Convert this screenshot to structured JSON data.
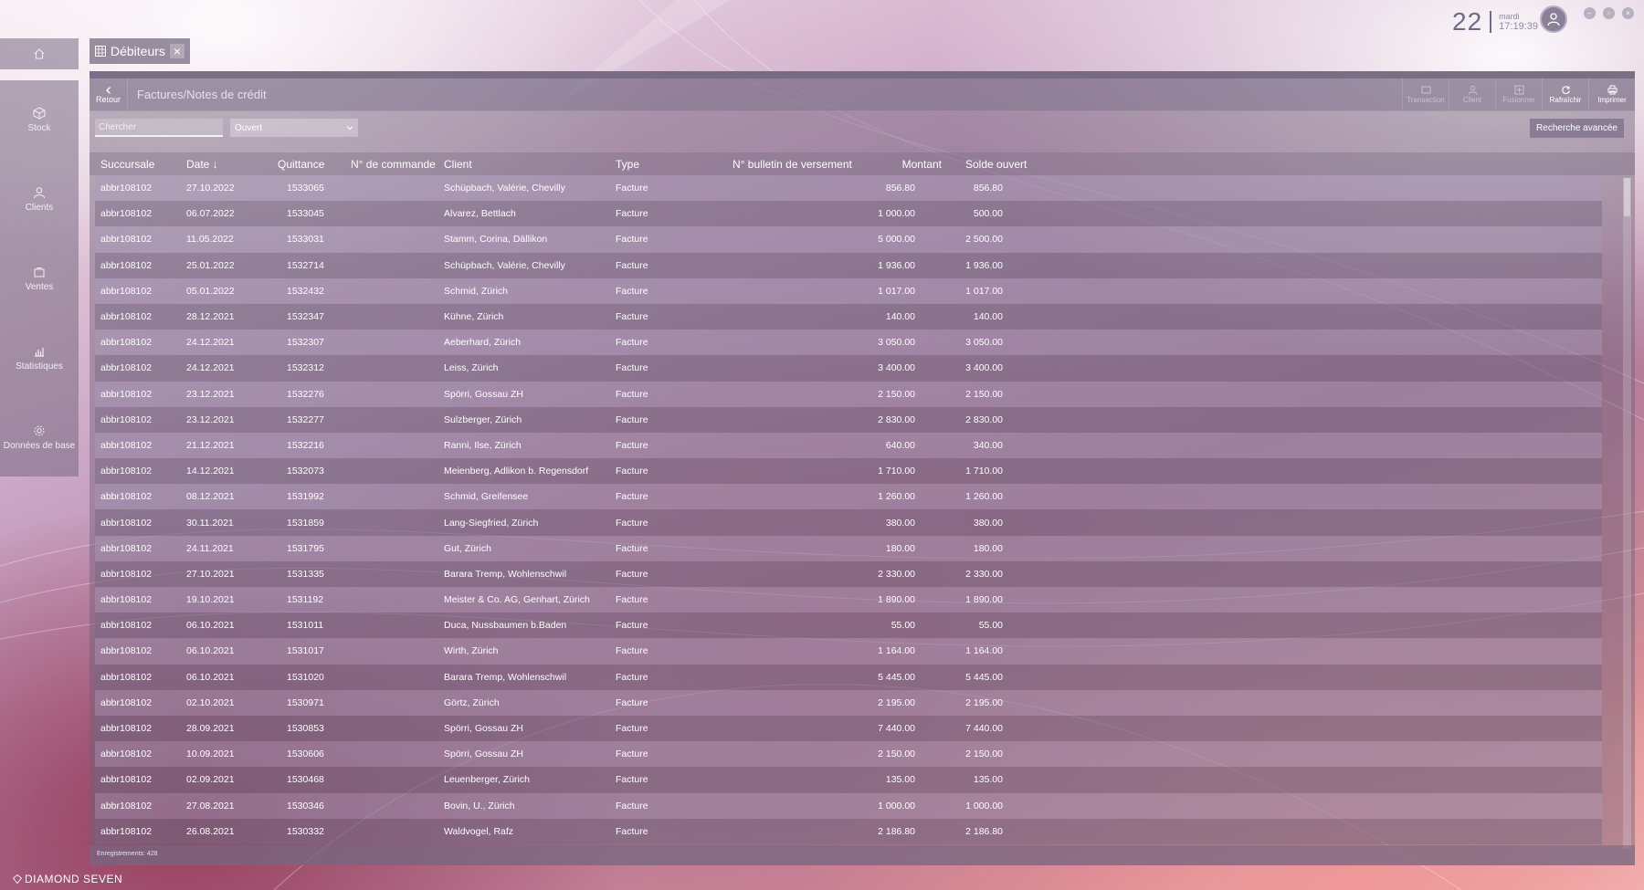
{
  "header": {
    "day": "22",
    "weekday": "mardi",
    "time": "17:19:39"
  },
  "sidebar": {
    "items": [
      {
        "label": "Stock",
        "icon": "box-icon"
      },
      {
        "label": "Clients",
        "icon": "person-icon"
      },
      {
        "label": "Ventes",
        "icon": "cart-icon"
      },
      {
        "label": "Statistiques",
        "icon": "bar-chart-icon"
      },
      {
        "label": "Données de base",
        "icon": "gear-icon"
      }
    ]
  },
  "tab": {
    "label": "Débiteurs"
  },
  "toolbar": {
    "back_label": "Retour",
    "breadcrumb": "Factures/Notes de crédit",
    "buttons": [
      {
        "label": "Transaction",
        "enabled": false
      },
      {
        "label": "Client",
        "enabled": false
      },
      {
        "label": "Fusionner",
        "enabled": false
      },
      {
        "label": "Rafraîchir",
        "enabled": true
      },
      {
        "label": "Imprimer",
        "enabled": true
      }
    ]
  },
  "filter": {
    "search_placeholder": "Chercher",
    "status_value": "Ouvert",
    "advanced_label": "Recherche avancée"
  },
  "table": {
    "columns": [
      "Succursale",
      "Date ↓",
      "Quittance",
      "N° de commande",
      "Client",
      "Type",
      "N° bulletin de versement",
      "Montant",
      "Solde ouvert"
    ],
    "rows": [
      [
        "abbr108102",
        "27.10.2022",
        "1533065",
        "",
        "Schüpbach, Valérie, Chevilly",
        "Facture",
        "",
        "856.80",
        "856.80"
      ],
      [
        "abbr108102",
        "06.07.2022",
        "1533045",
        "",
        "Alvarez, Bettlach",
        "Facture",
        "",
        "1 000.00",
        "500.00"
      ],
      [
        "abbr108102",
        "11.05.2022",
        "1533031",
        "",
        "Stamm, Corina, Dällikon",
        "Facture",
        "",
        "5 000.00",
        "2 500.00"
      ],
      [
        "abbr108102",
        "25.01.2022",
        "1532714",
        "",
        "Schüpbach, Valérie, Chevilly",
        "Facture",
        "",
        "1 936.00",
        "1 936.00"
      ],
      [
        "abbr108102",
        "05.01.2022",
        "1532432",
        "",
        "Schmid, Zürich",
        "Facture",
        "",
        "1 017.00",
        "1 017.00"
      ],
      [
        "abbr108102",
        "28.12.2021",
        "1532347",
        "",
        "Kühne, Zürich",
        "Facture",
        "",
        "140.00",
        "140.00"
      ],
      [
        "abbr108102",
        "24.12.2021",
        "1532307",
        "",
        "Aeberhard, Zürich",
        "Facture",
        "",
        "3 050.00",
        "3 050.00"
      ],
      [
        "abbr108102",
        "24.12.2021",
        "1532312",
        "",
        "Leiss, Zürich",
        "Facture",
        "",
        "3 400.00",
        "3 400.00"
      ],
      [
        "abbr108102",
        "23.12.2021",
        "1532276",
        "",
        "Spörri, Gossau ZH",
        "Facture",
        "",
        "2 150.00",
        "2 150.00"
      ],
      [
        "abbr108102",
        "23.12.2021",
        "1532277",
        "",
        "Sulzberger, Zürich",
        "Facture",
        "",
        "2 830.00",
        "2 830.00"
      ],
      [
        "abbr108102",
        "21.12.2021",
        "1532216",
        "",
        "Ranni, Ilse, Zürich",
        "Facture",
        "",
        "640.00",
        "340.00"
      ],
      [
        "abbr108102",
        "14.12.2021",
        "1532073",
        "",
        "Meienberg, Adlikon b. Regensdorf",
        "Facture",
        "",
        "1 710.00",
        "1 710.00"
      ],
      [
        "abbr108102",
        "08.12.2021",
        "1531992",
        "",
        "Schmid, Greifensee",
        "Facture",
        "",
        "1 260.00",
        "1 260.00"
      ],
      [
        "abbr108102",
        "30.11.2021",
        "1531859",
        "",
        "Lang-Siegfried, Zürich",
        "Facture",
        "",
        "380.00",
        "380.00"
      ],
      [
        "abbr108102",
        "24.11.2021",
        "1531795",
        "",
        "Gut, Zürich",
        "Facture",
        "",
        "180.00",
        "180.00"
      ],
      [
        "abbr108102",
        "27.10.2021",
        "1531335",
        "",
        "Barara Tremp, Wohlenschwil",
        "Facture",
        "",
        "2 330.00",
        "2 330.00"
      ],
      [
        "abbr108102",
        "19.10.2021",
        "1531192",
        "",
        "Meister & Co. AG, Genhart, Zürich",
        "Facture",
        "",
        "1 890.00",
        "1 890.00"
      ],
      [
        "abbr108102",
        "06.10.2021",
        "1531011",
        "",
        "Duca, Nussbaumen b.Baden",
        "Facture",
        "",
        "55.00",
        "55.00"
      ],
      [
        "abbr108102",
        "06.10.2021",
        "1531017",
        "",
        "Wirth, Zürich",
        "Facture",
        "",
        "1 164.00",
        "1 164.00"
      ],
      [
        "abbr108102",
        "06.10.2021",
        "1531020",
        "",
        "Barara Tremp, Wohlenschwil",
        "Facture",
        "",
        "5 445.00",
        "5 445.00"
      ],
      [
        "abbr108102",
        "02.10.2021",
        "1530971",
        "",
        "Görtz, Zürich",
        "Facture",
        "",
        "2 195.00",
        "2 195.00"
      ],
      [
        "abbr108102",
        "28.09.2021",
        "1530853",
        "",
        "Spörri, Gossau ZH",
        "Facture",
        "",
        "7 440.00",
        "7 440.00"
      ],
      [
        "abbr108102",
        "10.09.2021",
        "1530606",
        "",
        "Spörri, Gossau ZH",
        "Facture",
        "",
        "2 150.00",
        "2 150.00"
      ],
      [
        "abbr108102",
        "02.09.2021",
        "1530468",
        "",
        "Leuenberger, Zürich",
        "Facture",
        "",
        "135.00",
        "135.00"
      ],
      [
        "abbr108102",
        "27.08.2021",
        "1530346",
        "",
        "Bovin, U., Zürich",
        "Facture",
        "",
        "1 000.00",
        "1 000.00"
      ],
      [
        "abbr108102",
        "26.08.2021",
        "1530332",
        "",
        "Waldvogel, Rafz",
        "Facture",
        "",
        "2 186.80",
        "2 186.80"
      ]
    ]
  },
  "footer": {
    "records": "Enregistrements: 428"
  },
  "brand": {
    "logo_text": "DIAMOND SEVEN"
  }
}
